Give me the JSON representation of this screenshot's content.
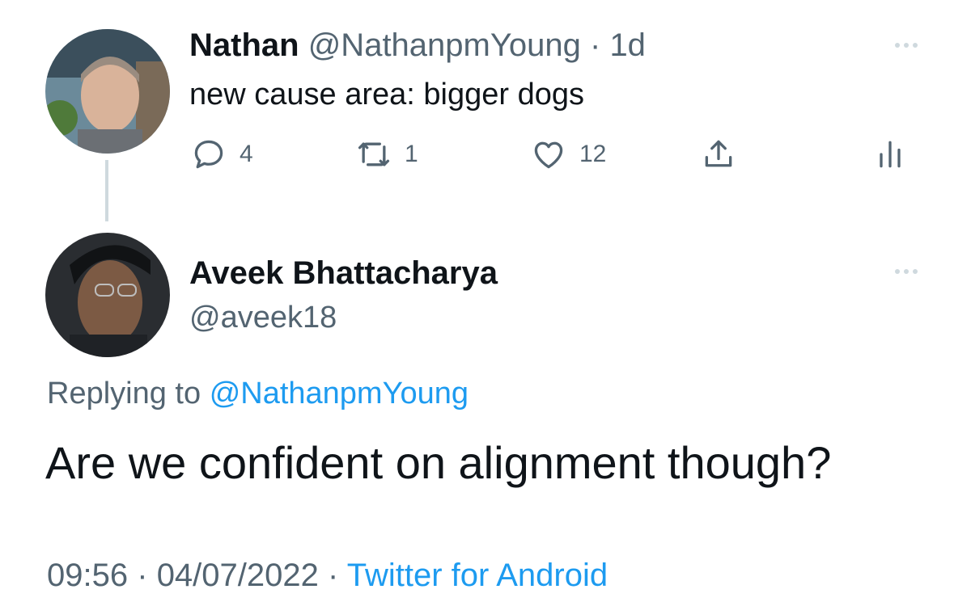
{
  "parent_tweet": {
    "author_name": "Nathan",
    "author_handle": "@NathanpmYoung",
    "separator": "·",
    "time": "1d",
    "text": "new cause area: bigger dogs",
    "stats": {
      "replies": "4",
      "retweets": "1",
      "likes": "12"
    }
  },
  "reply_tweet": {
    "author_name": "Aveek Bhattacharya",
    "author_handle": "@aveek18",
    "replying_to_label": "Replying to",
    "replying_to_handle": "@NathanpmYoung",
    "text": "Are we confident on alignment though?",
    "timestamp_time": "09:56",
    "separator": "·",
    "timestamp_date": "04/07/2022",
    "source": "Twitter for Android"
  },
  "colors": {
    "link": "#1d9bf0",
    "muted": "#536471",
    "text": "#0f1419",
    "thread_line": "#cfd9de"
  },
  "icons": [
    "reply-icon",
    "retweet-icon",
    "like-icon",
    "share-icon",
    "analytics-icon",
    "more-icon"
  ]
}
